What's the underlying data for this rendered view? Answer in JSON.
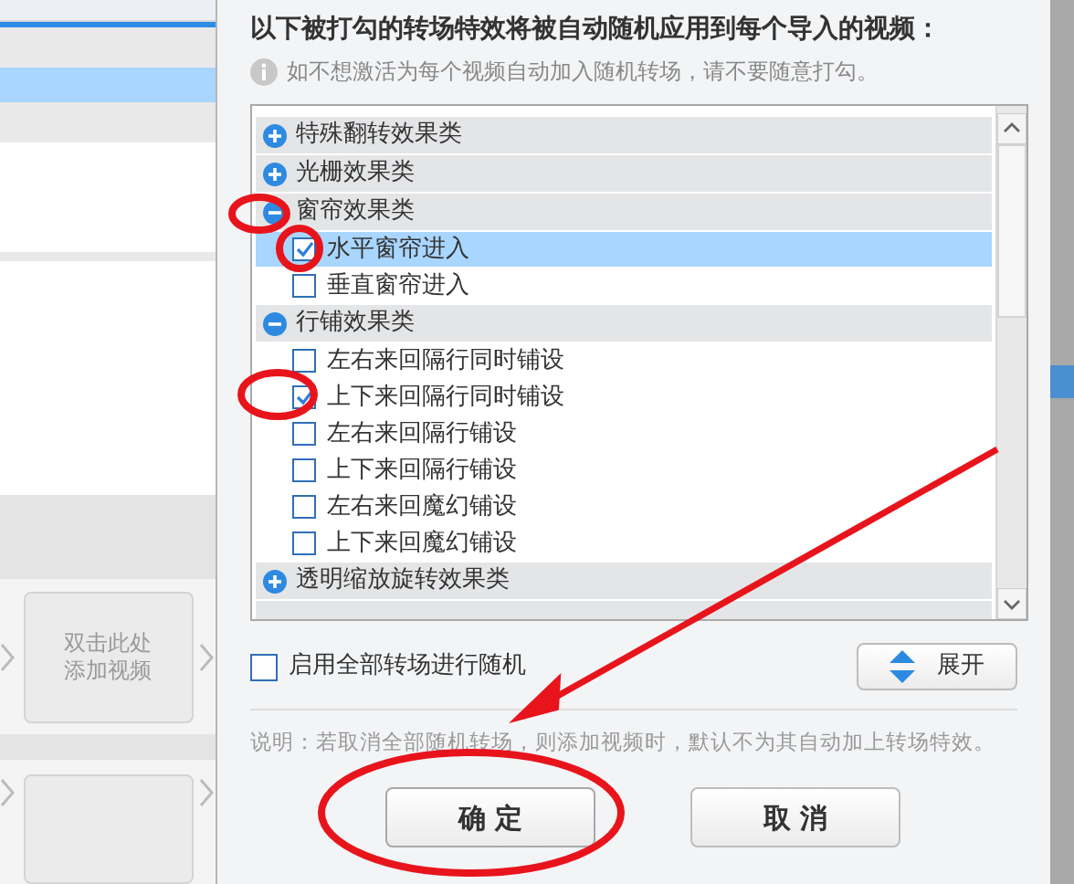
{
  "left_panel": {
    "card_lines": [
      "双击此处",
      "添加视频"
    ]
  },
  "dialog": {
    "title": "以下被打勾的转场特效将被自动随机应用到每个导入的视频：",
    "info": "如不想激活为每个视频自动加入随机转场，请不要随意打勾。",
    "groups": [
      {
        "label": "特殊翻转效果类",
        "expanded": false
      },
      {
        "label": "光栅效果类",
        "expanded": false
      },
      {
        "label": "窗帘效果类",
        "expanded": true,
        "items": [
          {
            "label": "水平窗帘进入",
            "checked": true,
            "selected": true
          },
          {
            "label": "垂直窗帘进入",
            "checked": false,
            "selected": false
          }
        ]
      },
      {
        "label": "行铺效果类",
        "expanded": true,
        "items": [
          {
            "label": "左右来回隔行同时铺设",
            "checked": false,
            "selected": false
          },
          {
            "label": "上下来回隔行同时铺设",
            "checked": true,
            "selected": false
          },
          {
            "label": "左右来回隔行铺设",
            "checked": false,
            "selected": false
          },
          {
            "label": "上下来回隔行铺设",
            "checked": false,
            "selected": false
          },
          {
            "label": "左右来回魔幻铺设",
            "checked": false,
            "selected": false
          },
          {
            "label": "上下来回魔幻铺设",
            "checked": false,
            "selected": false
          }
        ]
      },
      {
        "label": "透明缩放旋转效果类",
        "expanded": false
      }
    ],
    "random_all": {
      "label": "启用全部转场进行随机",
      "checked": false
    },
    "expand_button": "展开",
    "note": "说明：若取消全部随机转场，则添加视频时，默认不为其自动加上转场特效。",
    "buttons": [
      {
        "label": "确 定",
        "kind": "primary"
      },
      {
        "label": "取 消",
        "kind": "secondary"
      }
    ]
  }
}
